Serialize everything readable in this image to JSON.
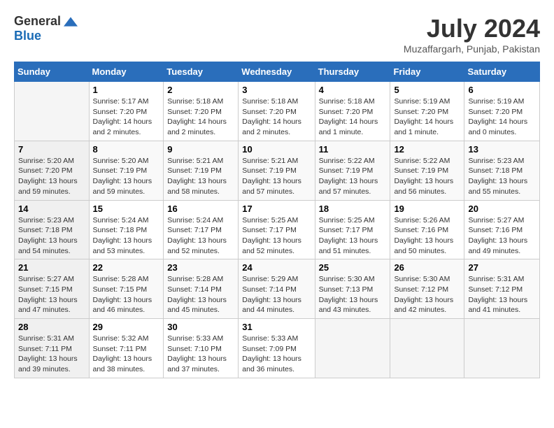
{
  "header": {
    "logo_general": "General",
    "logo_blue": "Blue",
    "month_year": "July 2024",
    "location": "Muzaffargarh, Punjab, Pakistan"
  },
  "calendar": {
    "days_of_week": [
      "Sunday",
      "Monday",
      "Tuesday",
      "Wednesday",
      "Thursday",
      "Friday",
      "Saturday"
    ],
    "weeks": [
      [
        {
          "day": "",
          "info": ""
        },
        {
          "day": "1",
          "info": "Sunrise: 5:17 AM\nSunset: 7:20 PM\nDaylight: 14 hours\nand 2 minutes."
        },
        {
          "day": "2",
          "info": "Sunrise: 5:18 AM\nSunset: 7:20 PM\nDaylight: 14 hours\nand 2 minutes."
        },
        {
          "day": "3",
          "info": "Sunrise: 5:18 AM\nSunset: 7:20 PM\nDaylight: 14 hours\nand 2 minutes."
        },
        {
          "day": "4",
          "info": "Sunrise: 5:18 AM\nSunset: 7:20 PM\nDaylight: 14 hours\nand 1 minute."
        },
        {
          "day": "5",
          "info": "Sunrise: 5:19 AM\nSunset: 7:20 PM\nDaylight: 14 hours\nand 1 minute."
        },
        {
          "day": "6",
          "info": "Sunrise: 5:19 AM\nSunset: 7:20 PM\nDaylight: 14 hours\nand 0 minutes."
        }
      ],
      [
        {
          "day": "7",
          "info": "Sunrise: 5:20 AM\nSunset: 7:20 PM\nDaylight: 13 hours\nand 59 minutes."
        },
        {
          "day": "8",
          "info": "Sunrise: 5:20 AM\nSunset: 7:19 PM\nDaylight: 13 hours\nand 59 minutes."
        },
        {
          "day": "9",
          "info": "Sunrise: 5:21 AM\nSunset: 7:19 PM\nDaylight: 13 hours\nand 58 minutes."
        },
        {
          "day": "10",
          "info": "Sunrise: 5:21 AM\nSunset: 7:19 PM\nDaylight: 13 hours\nand 57 minutes."
        },
        {
          "day": "11",
          "info": "Sunrise: 5:22 AM\nSunset: 7:19 PM\nDaylight: 13 hours\nand 57 minutes."
        },
        {
          "day": "12",
          "info": "Sunrise: 5:22 AM\nSunset: 7:19 PM\nDaylight: 13 hours\nand 56 minutes."
        },
        {
          "day": "13",
          "info": "Sunrise: 5:23 AM\nSunset: 7:18 PM\nDaylight: 13 hours\nand 55 minutes."
        }
      ],
      [
        {
          "day": "14",
          "info": "Sunrise: 5:23 AM\nSunset: 7:18 PM\nDaylight: 13 hours\nand 54 minutes."
        },
        {
          "day": "15",
          "info": "Sunrise: 5:24 AM\nSunset: 7:18 PM\nDaylight: 13 hours\nand 53 minutes."
        },
        {
          "day": "16",
          "info": "Sunrise: 5:24 AM\nSunset: 7:17 PM\nDaylight: 13 hours\nand 52 minutes."
        },
        {
          "day": "17",
          "info": "Sunrise: 5:25 AM\nSunset: 7:17 PM\nDaylight: 13 hours\nand 52 minutes."
        },
        {
          "day": "18",
          "info": "Sunrise: 5:25 AM\nSunset: 7:17 PM\nDaylight: 13 hours\nand 51 minutes."
        },
        {
          "day": "19",
          "info": "Sunrise: 5:26 AM\nSunset: 7:16 PM\nDaylight: 13 hours\nand 50 minutes."
        },
        {
          "day": "20",
          "info": "Sunrise: 5:27 AM\nSunset: 7:16 PM\nDaylight: 13 hours\nand 49 minutes."
        }
      ],
      [
        {
          "day": "21",
          "info": "Sunrise: 5:27 AM\nSunset: 7:15 PM\nDaylight: 13 hours\nand 47 minutes."
        },
        {
          "day": "22",
          "info": "Sunrise: 5:28 AM\nSunset: 7:15 PM\nDaylight: 13 hours\nand 46 minutes."
        },
        {
          "day": "23",
          "info": "Sunrise: 5:28 AM\nSunset: 7:14 PM\nDaylight: 13 hours\nand 45 minutes."
        },
        {
          "day": "24",
          "info": "Sunrise: 5:29 AM\nSunset: 7:14 PM\nDaylight: 13 hours\nand 44 minutes."
        },
        {
          "day": "25",
          "info": "Sunrise: 5:30 AM\nSunset: 7:13 PM\nDaylight: 13 hours\nand 43 minutes."
        },
        {
          "day": "26",
          "info": "Sunrise: 5:30 AM\nSunset: 7:12 PM\nDaylight: 13 hours\nand 42 minutes."
        },
        {
          "day": "27",
          "info": "Sunrise: 5:31 AM\nSunset: 7:12 PM\nDaylight: 13 hours\nand 41 minutes."
        }
      ],
      [
        {
          "day": "28",
          "info": "Sunrise: 5:31 AM\nSunset: 7:11 PM\nDaylight: 13 hours\nand 39 minutes."
        },
        {
          "day": "29",
          "info": "Sunrise: 5:32 AM\nSunset: 7:11 PM\nDaylight: 13 hours\nand 38 minutes."
        },
        {
          "day": "30",
          "info": "Sunrise: 5:33 AM\nSunset: 7:10 PM\nDaylight: 13 hours\nand 37 minutes."
        },
        {
          "day": "31",
          "info": "Sunrise: 5:33 AM\nSunset: 7:09 PM\nDaylight: 13 hours\nand 36 minutes."
        },
        {
          "day": "",
          "info": ""
        },
        {
          "day": "",
          "info": ""
        },
        {
          "day": "",
          "info": ""
        }
      ]
    ]
  }
}
